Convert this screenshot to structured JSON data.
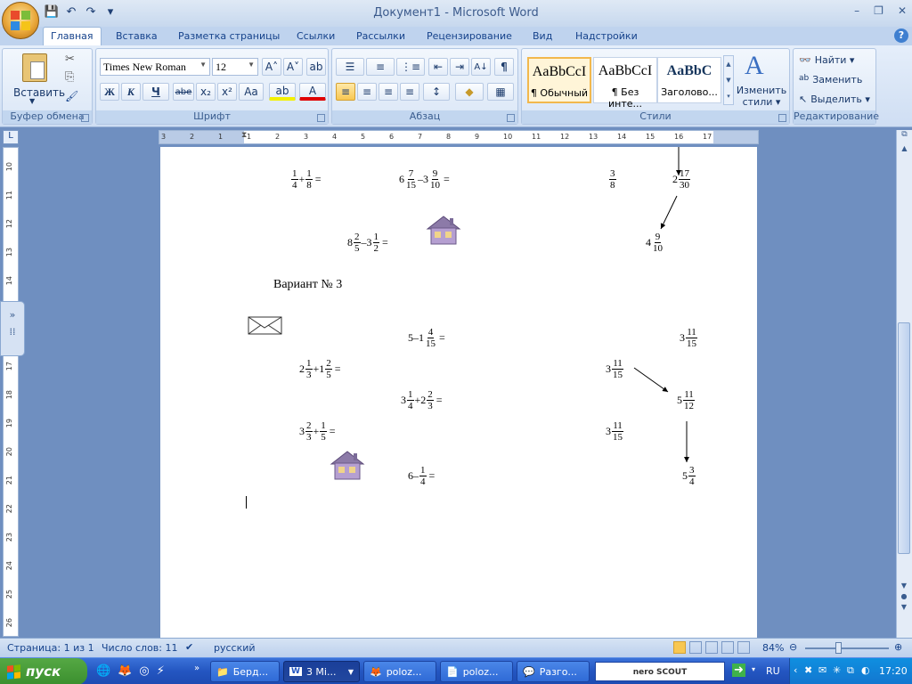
{
  "window": {
    "title": "Документ1 - Microsoft Word",
    "min": "–",
    "max": "❐",
    "close": "✕"
  },
  "qat": {
    "save": "💾",
    "undo": "↶",
    "redo": "↷",
    "more": "▾"
  },
  "tabs": [
    "Главная",
    "Вставка",
    "Разметка страницы",
    "Ссылки",
    "Рассылки",
    "Рецензирование",
    "Вид",
    "Надстройки"
  ],
  "help": "?",
  "ribbon": {
    "clipboard": {
      "label": "Буфер обмена",
      "paste": "Вставить",
      "cut": "✂",
      "copy": "⎘",
      "painter": "🖌"
    },
    "font": {
      "label": "Шрифт",
      "name": "Times New Roman",
      "size": "12",
      "grow": "A˄",
      "shrink": "A˅",
      "clear": "ab",
      "bold": "Ж",
      "italic": "К",
      "underline": "Ч",
      "strike": "abe",
      "sub": "x₂",
      "sup": "x²",
      "case": "Aa",
      "highlight": "ab",
      "color": "A"
    },
    "paragraph": {
      "label": "Абзац",
      "bullets": "☰",
      "numbers": "≡",
      "multilevel": "⋮≡",
      "outdent": "⇤",
      "indent": "⇥",
      "sort": "A↓",
      "pilcrow": "¶",
      "left": "≡",
      "center": "≡",
      "right": "≡",
      "justify": "≡",
      "spacing": "↕",
      "shading": "◆",
      "borders": "▦"
    },
    "styles": {
      "label": "Стили",
      "sample": "AaBbCcI",
      "sample3": "AaBbC",
      "normal": "¶ Обычный",
      "nospace": "¶ Без инте...",
      "heading": "Заголово...",
      "change1": "Изменить",
      "change2": "стили ▾"
    },
    "editing": {
      "label": "Редактирование",
      "find": "Найти ▾",
      "replace": "Заменить",
      "select": "Выделить ▾"
    }
  },
  "ruler": {
    "corner": "L",
    "h_ticks": [
      "3",
      "2",
      "1",
      "1",
      "2",
      "3",
      "4",
      "5",
      "6",
      "7",
      "8",
      "9",
      "10",
      "11",
      "12",
      "13",
      "14",
      "15",
      "16",
      "17"
    ],
    "v_ticks": [
      "10",
      "11",
      "12",
      "13",
      "14",
      "15",
      "16",
      "17",
      "18",
      "19",
      "20",
      "21",
      "22",
      "23",
      "24",
      "25",
      "26"
    ]
  },
  "doc": {
    "variant": "Вариант № 3",
    "r1": {
      "a1": "1",
      "a2": "4",
      "p": "+",
      "b1": "1",
      "b2": "8",
      "eq": "=",
      "c0": "6",
      "c1": "7",
      "c2": "15",
      "minus": "–",
      "c3": "3",
      "c4": "9",
      "c5": "10",
      "eq2": "=",
      "d1": "3",
      "d2": "8",
      "e0": "2",
      "e1": "17",
      "e2": "30"
    },
    "r2": {
      "w": "8",
      "n1": "2",
      "d1": "5",
      "minus": "–",
      "w2": "3",
      "n2": "1",
      "d2": "2",
      "eq": "=",
      "w3": "4",
      "n3": "9",
      "d3": "10"
    },
    "v1": {
      "w": "5",
      "minus": "–",
      "w2": "1",
      "n": "4",
      "d": "15",
      "eq": "=",
      "rw": "3",
      "rn": "11",
      "rd": "15"
    },
    "v2": {
      "w": "2",
      "n": "1",
      "d": "3",
      "plus": "+",
      "w2": "1",
      "n2": "2",
      "d2": "5",
      "eq": "=",
      "rw": "3",
      "rn": "11",
      "rd": "15"
    },
    "v3": {
      "w": "3",
      "n": "1",
      "d": "4",
      "plus": "+",
      "w2": "2",
      "n2": "2",
      "d2": "3",
      "eq": "=",
      "rw": "5",
      "rn": "11",
      "rd": "12"
    },
    "v4": {
      "w": "3",
      "n": "2",
      "d": "3",
      "plus": "+",
      "n2": "1",
      "d2": "5",
      "eq": "=",
      "rw": "3",
      "rn": "11",
      "rd": "15"
    },
    "v5": {
      "w": "6",
      "minus": "–",
      "n": "1",
      "d": "4",
      "eq": "=",
      "rw": "5",
      "rn": "3",
      "rd": "4"
    }
  },
  "status": {
    "page": "Страница: 1 из 1",
    "words": "Число слов: 11",
    "lang": "русский",
    "zoom": "84%"
  },
  "taskbar": {
    "start": "пуск",
    "tasks": [
      "Берд...",
      "3 Mi...",
      "poloz...",
      "poloz...",
      "Разго..."
    ],
    "nero": "nero SCOUT",
    "lang": "RU",
    "time": "17:20"
  }
}
